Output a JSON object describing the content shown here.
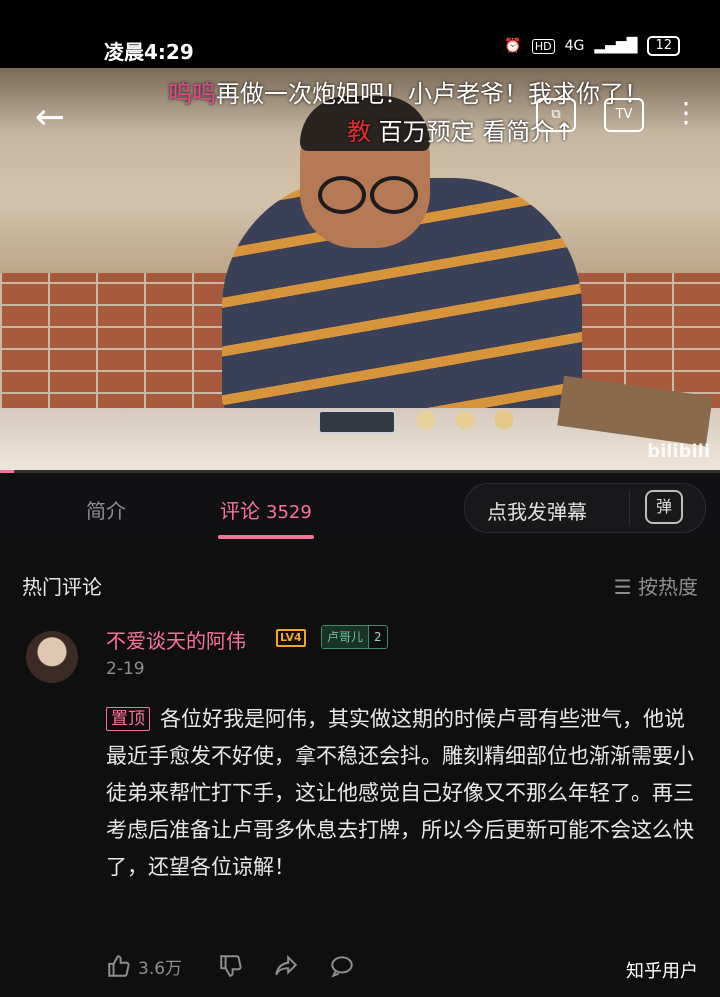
{
  "status_bar": {
    "time": "凌晨4:29",
    "network": "4G",
    "battery": "12"
  },
  "video": {
    "danmaku_line1_pink": "呜呜",
    "danmaku_line1": "再做一次炮姐吧！小卢老爷！我求你了！",
    "danmaku_line2_red": "教",
    "danmaku_line2": "百万预定  看简介↑",
    "watermark": "bilibili",
    "progress": 0.02
  },
  "tabs": {
    "intro": "简介",
    "comments": "评论",
    "comments_count": "3529",
    "danmu_button": "点我发弹幕",
    "danmu_icon_label": "弹"
  },
  "comments": {
    "hot_title": "热门评论",
    "sort_label": "按热度",
    "items": [
      {
        "username": "不爱谈天的阿伟",
        "level": "LV4",
        "fan_badge_name": "卢哥儿",
        "fan_badge_level": "2",
        "date": "2-19",
        "pinned_label": "置顶",
        "text": "各位好我是阿伟，其实做这期的时候卢哥有些泄气，他说最近手愈发不好使，拿不稳还会抖。雕刻精细部位也渐渐需要小徒弟来帮忙打下手，这让他感觉自己好像又不那么年轻了。再三考虑后准备让卢哥多休息去打牌，所以今后更新可能不会这么快了，还望各位谅解！",
        "likes": "3.6万"
      }
    ]
  },
  "watermark_zhihu": "知乎用户"
}
